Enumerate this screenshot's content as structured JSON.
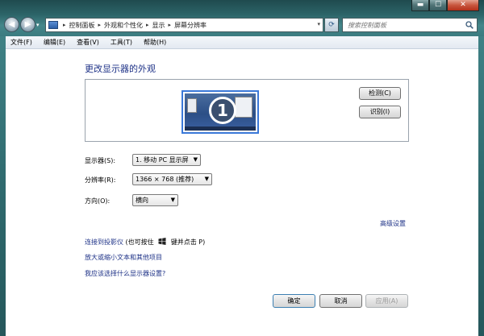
{
  "window": {
    "controls": {
      "minimize": "▬",
      "maximize": "☐",
      "close": "✕"
    }
  },
  "address_bar": {
    "crumbs": [
      "控制面板",
      "外观和个性化",
      "显示",
      "屏幕分辨率"
    ],
    "separator": "▸",
    "dropdown_glyph": "▾"
  },
  "search": {
    "placeholder": "搜索控制面板"
  },
  "menubar": {
    "items": [
      "文件(F)",
      "编辑(E)",
      "查看(V)",
      "工具(T)",
      "帮助(H)"
    ]
  },
  "page": {
    "title": "更改显示器的外观",
    "preview": {
      "monitor_number": "1"
    },
    "buttons": {
      "detect": "检测(C)",
      "identify": "识别(I)"
    },
    "settings": {
      "display_label": "显示器(S):",
      "display_value": "1. 移动 PC 显示屏",
      "resolution_label": "分辨率(R):",
      "resolution_value": "1366 × 768 (推荐)",
      "orientation_label": "方向(O):",
      "orientation_value": "横向"
    },
    "links": {
      "advanced": "高级设置",
      "projector": "连接到投影仪",
      "projector_hint_pre": "(也可按住",
      "projector_hint_post": "键并点击 P)",
      "text_size": "放大或缩小文本和其他项目",
      "help": "我应该选择什么显示器设置?"
    },
    "footer": {
      "ok": "确定",
      "cancel": "取消",
      "apply": "应用(A)"
    }
  },
  "colors": {
    "link": "#1e3287",
    "selection_border": "#3a78d8",
    "chrome": "#2c6468"
  }
}
